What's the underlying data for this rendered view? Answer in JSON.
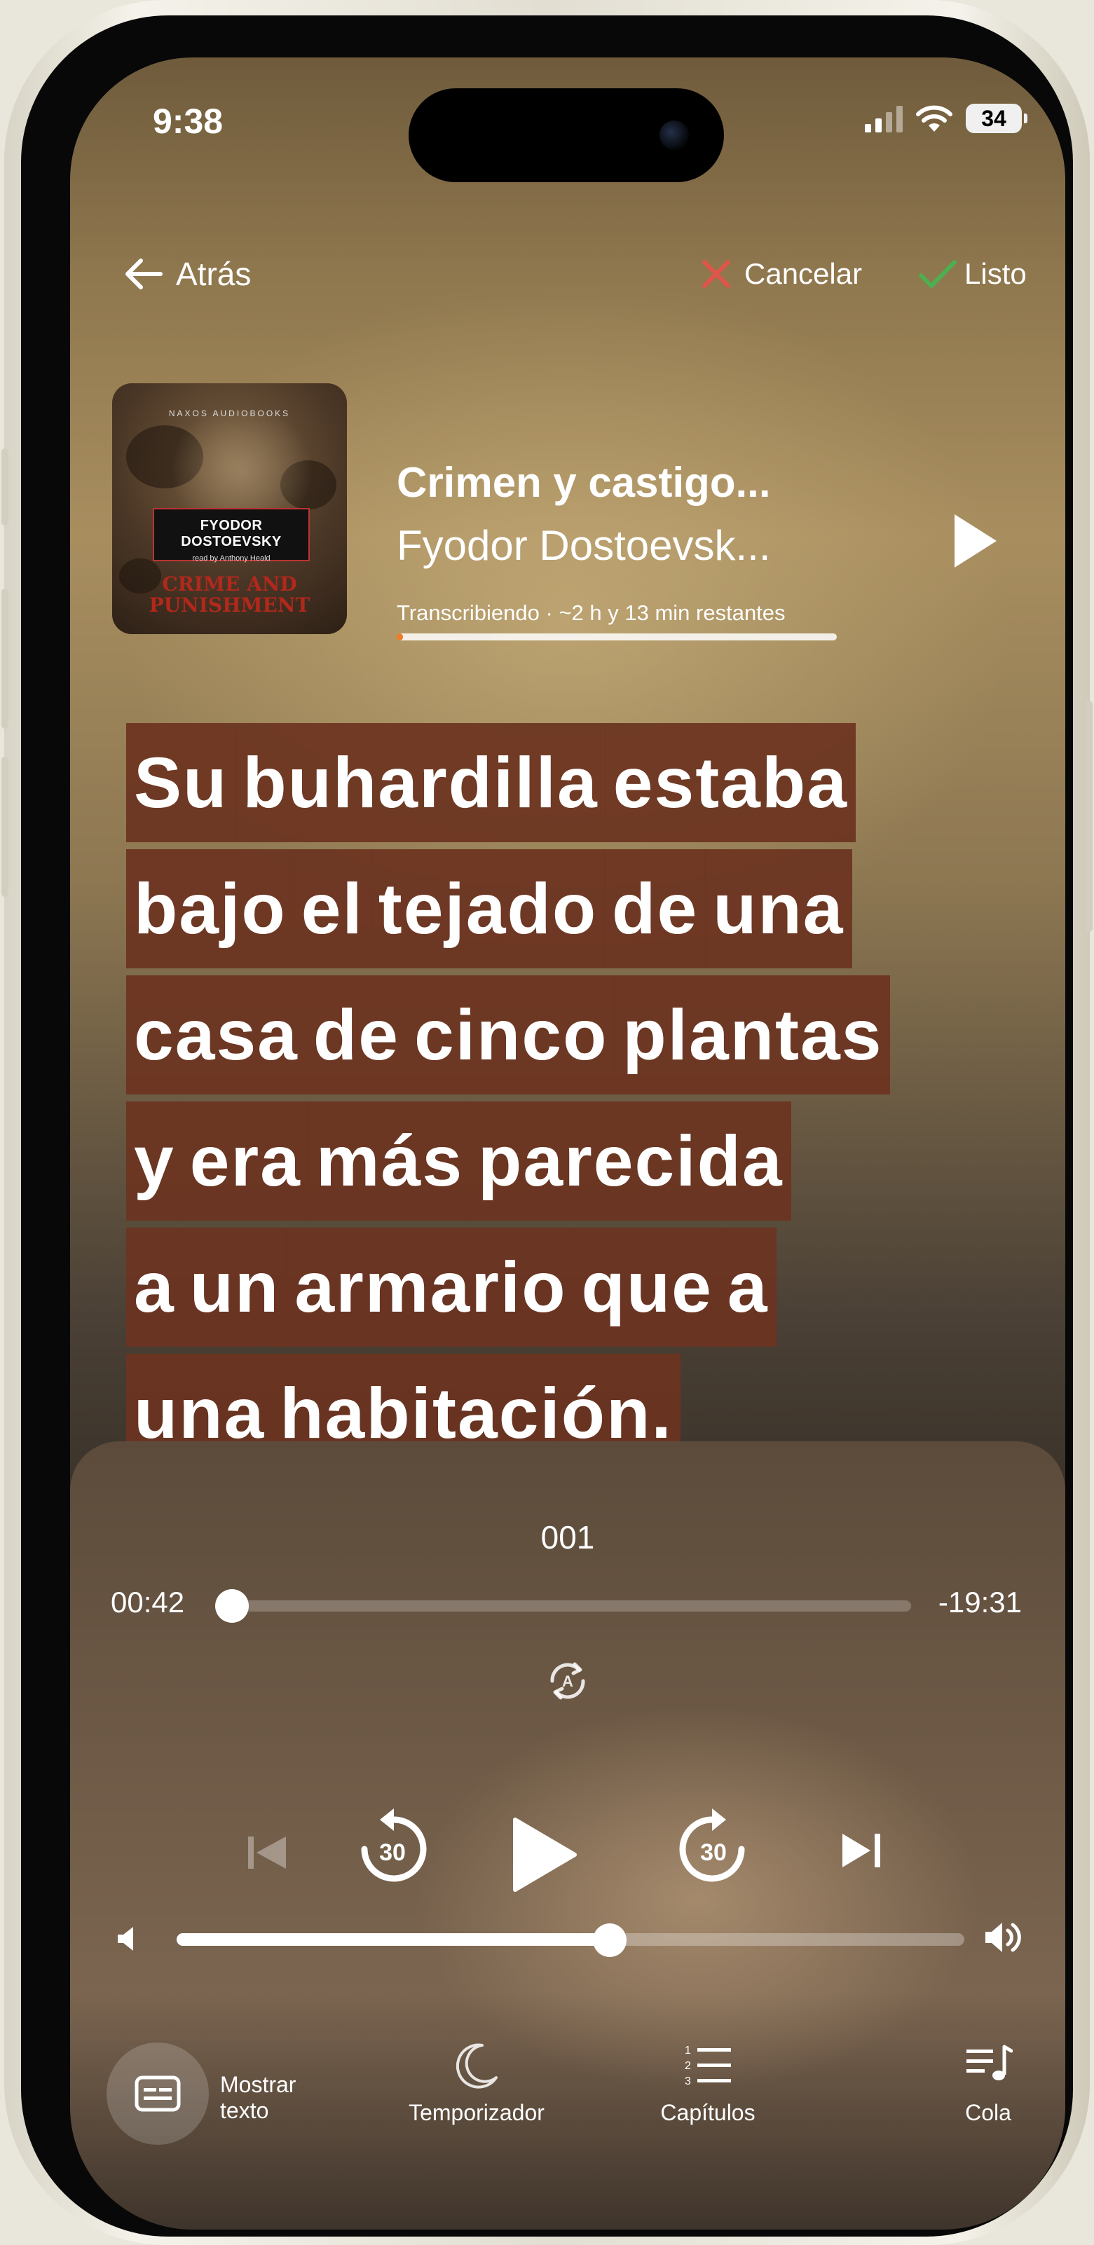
{
  "status_bar": {
    "time": "9:38",
    "battery": "34"
  },
  "nav": {
    "back_label": "Atrás",
    "cancel_label": "Cancelar",
    "done_label": "Listo"
  },
  "book": {
    "title": "Crimen y castigo...",
    "author": "Fyodor Dostoevsk...",
    "cover": {
      "publisher": "NAXOS AUDIOBOOKS",
      "author": "FYODOR DOSTOEVSKY",
      "reader": "read by Anthony Heald",
      "title_line1": "CRIME AND",
      "title_line2": "PUNISHMENT"
    },
    "transcription_status": "Transcribiendo · ~2 h y 13 min restantes",
    "transcription_progress": 0.015
  },
  "transcript": {
    "lines": [
      [
        "Su",
        "buhardilla",
        "estaba"
      ],
      [
        "bajo",
        "el",
        "tejado",
        "de",
        "una"
      ],
      [
        "casa",
        "de",
        "cinco",
        "plantas"
      ],
      [
        "y",
        "era",
        "más",
        "parecida"
      ],
      [
        "a",
        "un",
        "armario",
        "que",
        "a"
      ],
      [
        "una",
        "habitación."
      ]
    ]
  },
  "player": {
    "track_title": "001",
    "elapsed": "00:42",
    "remaining": "-19:31",
    "position_fraction": 0.015,
    "skip_back_seconds": "30",
    "skip_forward_seconds": "30",
    "volume_fraction": 0.55
  },
  "bottom_bar": {
    "show_text": "Mostrar texto",
    "timer": "Temporizador",
    "chapters": "Capítulos",
    "queue": "Cola"
  },
  "colors": {
    "accent_progress": "#f07c28",
    "highlight_bg": "#6c3420",
    "cancel_icon": "#e0554a",
    "done_icon": "#4caf50"
  }
}
